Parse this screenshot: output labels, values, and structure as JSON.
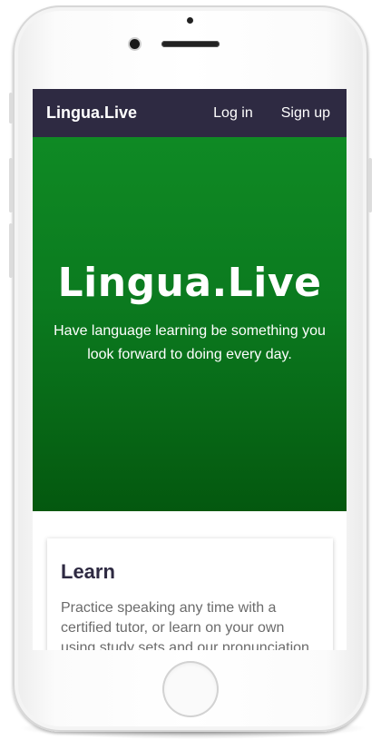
{
  "navbar": {
    "brand": "Lingua.Live",
    "login_label": "Log in",
    "signup_label": "Sign up"
  },
  "hero": {
    "title": "Lingua.Live",
    "subtitle": "Have language learning be something you look forward to doing every day."
  },
  "cards": [
    {
      "title": "Learn",
      "text": "Practice speaking any time with a certified tutor, or learn on your own using study sets and our pronunciation"
    }
  ],
  "colors": {
    "navbar_bg": "#2e2a42",
    "hero_green": "#0b7a1f"
  }
}
